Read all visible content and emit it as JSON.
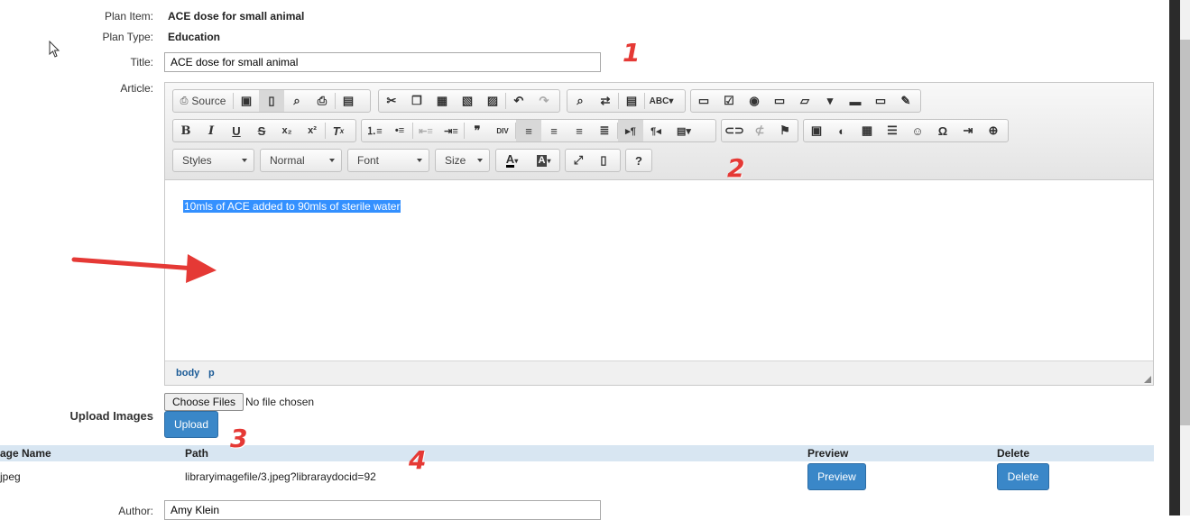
{
  "form": {
    "plan_item_label": "Plan Item:",
    "plan_item_value": "ACE dose for small animal",
    "plan_type_label": "Plan Type:",
    "plan_type_value": "Education",
    "title_label": "Title:",
    "title_value": "ACE dose for small animal",
    "article_label": "Article:",
    "upload_images_label": "Upload Images",
    "choose_files_label": "Choose Files",
    "no_file_text": "No file chosen",
    "upload_button": "Upload",
    "author_label": "Author:",
    "author_value": "Amy Klein"
  },
  "editor": {
    "source_label": "Source",
    "styles_combo": "Styles",
    "format_combo": "Normal",
    "font_combo": "Font",
    "size_combo": "Size",
    "help_label": "?",
    "content_text": "10mls of ACE added to 90mls of sterile water",
    "path_body": "body",
    "path_p": "p"
  },
  "images_table": {
    "headers": [
      "age Name",
      "Path",
      "Preview",
      "Delete"
    ],
    "rows": [
      {
        "name": "jpeg",
        "path": "libraryimagefile/3.jpeg?libraraydocid=92",
        "preview_label": "Preview",
        "delete_label": "Delete"
      }
    ]
  },
  "annotations": [
    "1",
    "2",
    "3",
    "4"
  ],
  "colors": {
    "accent_button": "#3a87c8",
    "selection": "#3390ff",
    "table_header": "#d8e6f2",
    "annotation": "#e53935"
  }
}
